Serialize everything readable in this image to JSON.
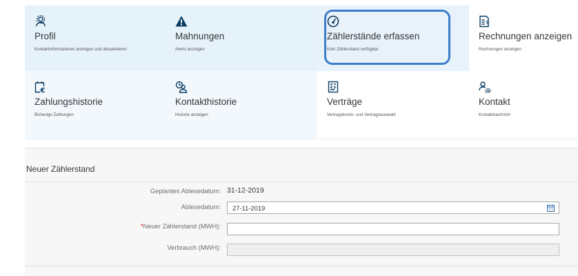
{
  "tiles": [
    {
      "title": "Profil",
      "subtitle": "Kontaktinformationen anzeigen und aktualisieren",
      "icon": "profile-settings-icon"
    },
    {
      "title": "Mahnungen",
      "subtitle": "Alerts anzeigen",
      "icon": "warning-icon"
    },
    {
      "title": "Zählerstände erfassen",
      "subtitle": "Kein Zählerstand verfügbar",
      "icon": "meter-gauge-icon"
    },
    {
      "title": "Rechnungen anzeigen",
      "subtitle": "Rechnungen anzeigen",
      "icon": "invoice-icon"
    },
    {
      "title": "Zahlungshistorie",
      "subtitle": "Bisherige Zahlungen",
      "icon": "payment-calendar-icon"
    },
    {
      "title": "Kontakthistorie",
      "subtitle": "Historie anzeigen",
      "icon": "contact-history-icon"
    },
    {
      "title": "Verträge",
      "subtitle": "Vertragskonto- und Vertragsauswahl",
      "icon": "contract-icon"
    },
    {
      "title": "Kontakt",
      "subtitle": "Kontaktnachricht",
      "icon": "contact-at-icon"
    }
  ],
  "form": {
    "title": "Neuer Zählerstand",
    "planned_label": "Geplantes Ablesedatum:",
    "planned_value": "31-12-2019",
    "reading_date_label": "Ablesedatum:",
    "reading_date_value": "27-11-2019",
    "required_mark": "*",
    "new_reading_label": "Neuer Zählerstand (MWH):",
    "new_reading_value": "",
    "consumption_label": "Verbrauch (MWH):",
    "consumption_value": ""
  },
  "colors": {
    "accent": "#3d7cc9",
    "tile_blue": "#e6f2f9",
    "icon": "#0a3b62"
  }
}
